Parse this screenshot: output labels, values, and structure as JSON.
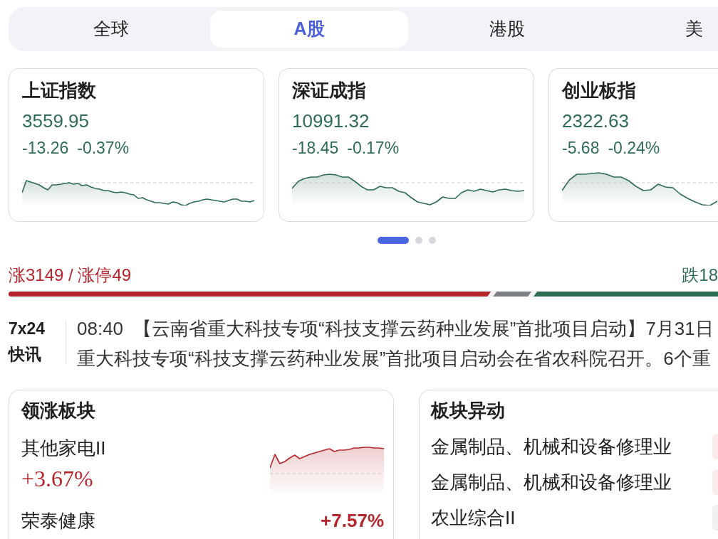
{
  "market_tabs": [
    {
      "label": "全球",
      "selected": false
    },
    {
      "label": "A股",
      "selected": true
    },
    {
      "label": "港股",
      "selected": false
    },
    {
      "label": "美",
      "selected": false
    }
  ],
  "index_cards": [
    {
      "name": "上证指数",
      "value": "3559.95",
      "change": "-13.26",
      "change_pct": "-0.37%",
      "kind": "down"
    },
    {
      "name": "深证成指",
      "value": "10991.32",
      "change": "-18.45",
      "change_pct": "-0.17%",
      "kind": "down"
    },
    {
      "name": "创业板指",
      "value": "2322.63",
      "change": "-5.68",
      "change_pct": "-0.24%",
      "kind": "down"
    }
  ],
  "pager": [
    {
      "selected": true
    },
    {
      "selected": false
    },
    {
      "selected": false
    }
  ],
  "breadth": {
    "up_label": "涨3149 / 涨停49",
    "down_label": "跌18",
    "segments": [
      {
        "kind": "up",
        "level": 0.68
      },
      {
        "kind": "flat"
      },
      {
        "kind": "down",
        "level": 0.26
      }
    ]
  },
  "news": {
    "badge_lines": [
      "7x24",
      "快讯"
    ],
    "time": "08:40",
    "lines": [
      "【云南省重大科技专项“科技支撑云药种业发展”首批项目启动】7月31日",
      "重大科技专项“科技支撑云药种业发展”首批项目启动会在省农科院召开。6个重"
    ]
  },
  "leading_sectors": {
    "title": "领涨板块",
    "sector": {
      "name": "其他家电II",
      "change_pct": "+3.67%",
      "kind": "up"
    },
    "stock": {
      "name": "荣泰健康",
      "change_pct": "+7.57%",
      "kind": "up"
    }
  },
  "sector_movers": {
    "title": "板块异动",
    "items": [
      {
        "name": "金属制品、机械和设备修理业",
        "color": "#fcebec"
      },
      {
        "name": "金属制品、机械和设备修理业",
        "color": "#fcebec"
      },
      {
        "name": "农业综合II",
        "color": "#eef1ef"
      }
    ]
  }
}
